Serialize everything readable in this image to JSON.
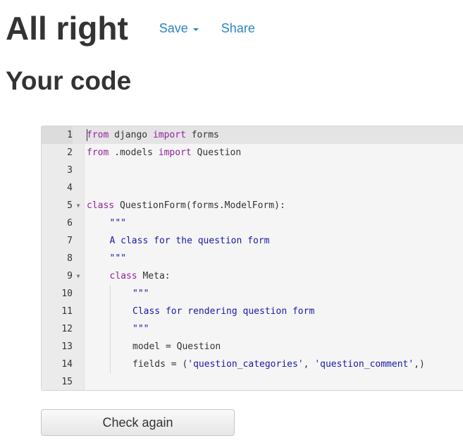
{
  "header": {
    "title": "All right",
    "save_label": "Save",
    "share_label": "Share"
  },
  "section": {
    "title": "Your code"
  },
  "editor": {
    "lines": [
      {
        "number": "1",
        "tokens": [
          {
            "t": "from",
            "c": "kw"
          },
          {
            "t": " django ",
            "c": "plain"
          },
          {
            "t": "import",
            "c": "kw"
          },
          {
            "t": " forms",
            "c": "plain"
          }
        ]
      },
      {
        "number": "2",
        "tokens": [
          {
            "t": "from",
            "c": "kw"
          },
          {
            "t": " .models ",
            "c": "plain"
          },
          {
            "t": "import",
            "c": "kw"
          },
          {
            "t": " Question",
            "c": "plain"
          }
        ]
      },
      {
        "number": "3",
        "tokens": []
      },
      {
        "number": "4",
        "tokens": []
      },
      {
        "number": "5",
        "fold": true,
        "tokens": [
          {
            "t": "class",
            "c": "kw"
          },
          {
            "t": " QuestionForm(forms.ModelForm):",
            "c": "plain"
          }
        ]
      },
      {
        "number": "6",
        "indent": 1,
        "tokens": [
          {
            "t": "\"\"\"",
            "c": "str"
          }
        ]
      },
      {
        "number": "7",
        "indent": 1,
        "tokens": [
          {
            "t": "A class for the question form",
            "c": "str"
          }
        ]
      },
      {
        "number": "8",
        "indent": 1,
        "tokens": [
          {
            "t": "\"\"\"",
            "c": "str"
          }
        ]
      },
      {
        "number": "9",
        "fold": true,
        "indent": 1,
        "tokens": [
          {
            "t": "class",
            "c": "kw"
          },
          {
            "t": " Meta:",
            "c": "plain"
          }
        ]
      },
      {
        "number": "10",
        "indent": 2,
        "tokens": [
          {
            "t": "\"\"\"",
            "c": "str"
          }
        ]
      },
      {
        "number": "11",
        "indent": 2,
        "tokens": [
          {
            "t": "Class for rendering question form",
            "c": "str"
          }
        ]
      },
      {
        "number": "12",
        "indent": 2,
        "tokens": [
          {
            "t": "\"\"\"",
            "c": "str"
          }
        ]
      },
      {
        "number": "13",
        "indent": 2,
        "tokens": [
          {
            "t": "model = Question",
            "c": "plain"
          }
        ]
      },
      {
        "number": "14",
        "indent": 2,
        "tokens": [
          {
            "t": "fields = (",
            "c": "plain"
          },
          {
            "t": "'question_categories'",
            "c": "str"
          },
          {
            "t": ", ",
            "c": "plain"
          },
          {
            "t": "'question_comment'",
            "c": "str"
          },
          {
            "t": ",)",
            "c": "plain"
          }
        ]
      },
      {
        "number": "15",
        "tokens": []
      }
    ]
  },
  "actions": {
    "check_again_label": "Check again"
  },
  "colors": {
    "link": "#2a86c2",
    "keyword": "#93219f",
    "string": "#1a1aa6"
  }
}
